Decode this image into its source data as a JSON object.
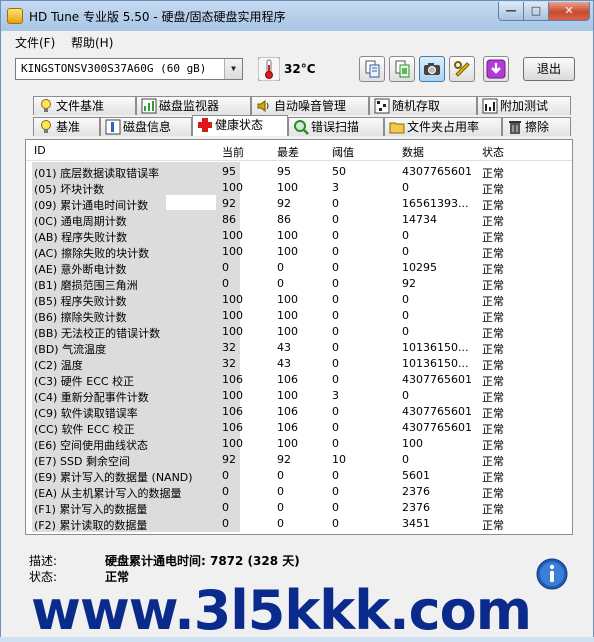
{
  "window": {
    "title": "HD Tune 专业版 5.50 - 硬盘/固态硬盘实用程序",
    "min_symbol": "—",
    "max_symbol": "□",
    "close_symbol": "✕"
  },
  "menu": [
    "文件(F)",
    "帮助(H)"
  ],
  "toolbar": {
    "drive": "KINGSTONSV300S37A60G (60 gB)",
    "temperature": "32°C",
    "exit_label": "退出",
    "icons": [
      "copy-text-icon",
      "copy-screen-icon",
      "camera-icon",
      "options-icon",
      "save-icon"
    ]
  },
  "tabs_row1": [
    "文件基准",
    "磁盘监视器",
    "自动噪音管理",
    "随机存取",
    "附加测试"
  ],
  "tabs_row2": [
    "基准",
    "磁盘信息",
    "健康状态",
    "错误扫描",
    "文件夹占用率",
    "擦除"
  ],
  "active_tab": "健康状态",
  "table": {
    "headers": [
      "ID",
      "当前",
      "最差",
      "阈值",
      "数据",
      "状态"
    ],
    "rows": [
      {
        "id": "(01) 底层数据读取错误率",
        "cur": "95",
        "worst": "95",
        "thr": "50",
        "data": "4307765601",
        "status": "正常"
      },
      {
        "id": "(05) 坏块计数",
        "cur": "100",
        "worst": "100",
        "thr": "3",
        "data": "0",
        "status": "正常"
      },
      {
        "id": "(09) 累计通电时间计数",
        "cur": "92",
        "worst": "92",
        "thr": "0",
        "data": "16561393...",
        "status": "正常"
      },
      {
        "id": "(0C) 通电周期计数",
        "cur": "86",
        "worst": "86",
        "thr": "0",
        "data": "14734",
        "status": "正常"
      },
      {
        "id": "(AB) 程序失败计数",
        "cur": "100",
        "worst": "100",
        "thr": "0",
        "data": "0",
        "status": "正常"
      },
      {
        "id": "(AC) 擦除失败的块计数",
        "cur": "100",
        "worst": "100",
        "thr": "0",
        "data": "0",
        "status": "正常"
      },
      {
        "id": "(AE) 意外断电计数",
        "cur": "0",
        "worst": "0",
        "thr": "0",
        "data": "10295",
        "status": "正常"
      },
      {
        "id": "(B1) 磨损范围三角洲",
        "cur": "0",
        "worst": "0",
        "thr": "0",
        "data": "92",
        "status": "正常"
      },
      {
        "id": "(B5) 程序失败计数",
        "cur": "100",
        "worst": "100",
        "thr": "0",
        "data": "0",
        "status": "正常"
      },
      {
        "id": "(B6) 擦除失败计数",
        "cur": "100",
        "worst": "100",
        "thr": "0",
        "data": "0",
        "status": "正常"
      },
      {
        "id": "(BB) 无法校正的错误计数",
        "cur": "100",
        "worst": "100",
        "thr": "0",
        "data": "0",
        "status": "正常"
      },
      {
        "id": "(BD) 气流温度",
        "cur": "32",
        "worst": "43",
        "thr": "0",
        "data": "10136150...",
        "status": "正常"
      },
      {
        "id": "(C2) 温度",
        "cur": "32",
        "worst": "43",
        "thr": "0",
        "data": "10136150...",
        "status": "正常"
      },
      {
        "id": "(C3) 硬件 ECC 校正",
        "cur": "106",
        "worst": "106",
        "thr": "0",
        "data": "4307765601",
        "status": "正常"
      },
      {
        "id": "(C4) 重新分配事件计数",
        "cur": "100",
        "worst": "100",
        "thr": "3",
        "data": "0",
        "status": "正常"
      },
      {
        "id": "(C9) 软件读取错误率",
        "cur": "106",
        "worst": "106",
        "thr": "0",
        "data": "4307765601",
        "status": "正常"
      },
      {
        "id": "(CC) 软件 ECC 校正",
        "cur": "106",
        "worst": "106",
        "thr": "0",
        "data": "4307765601",
        "status": "正常"
      },
      {
        "id": "(E6) 空间使用曲线状态",
        "cur": "100",
        "worst": "100",
        "thr": "0",
        "data": "100",
        "status": "正常"
      },
      {
        "id": "(E7) SSD 剩余空间",
        "cur": "92",
        "worst": "92",
        "thr": "10",
        "data": "0",
        "status": "正常"
      },
      {
        "id": "(E9) 累计写入的数据量 (NAND)",
        "cur": "0",
        "worst": "0",
        "thr": "0",
        "data": "5601",
        "status": "正常"
      },
      {
        "id": "(EA) 从主机累计写入的数据量",
        "cur": "0",
        "worst": "0",
        "thr": "0",
        "data": "2376",
        "status": "正常"
      },
      {
        "id": "(F1) 累计写入的数据量",
        "cur": "0",
        "worst": "0",
        "thr": "0",
        "data": "2376",
        "status": "正常"
      },
      {
        "id": "(F2) 累计读取的数据量",
        "cur": "0",
        "worst": "0",
        "thr": "0",
        "data": "3451",
        "status": "正常"
      }
    ]
  },
  "details": {
    "desc_label": "描述:",
    "desc_value": "硬盘累计通电时间: 7872 (328 天)",
    "status_label": "状态:",
    "status_value": "正常"
  },
  "watermark": "www.3l5kkk.com",
  "colors": {
    "accent": "#3c7fb1",
    "watermark": "#0a2a8c",
    "close": "#c94a2f"
  }
}
